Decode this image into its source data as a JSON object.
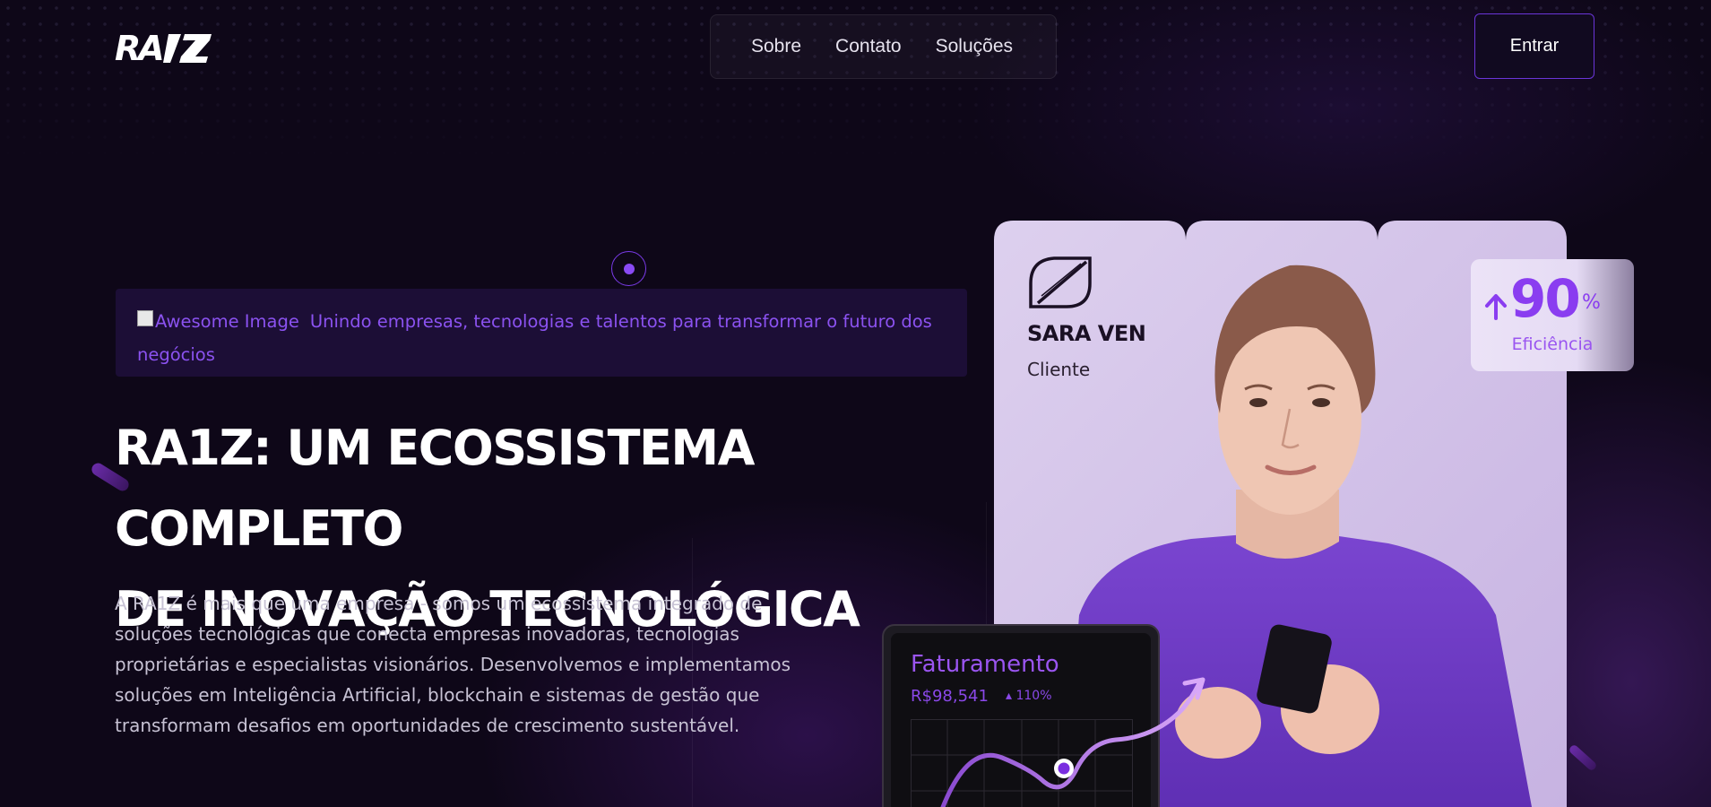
{
  "header": {
    "logo_text": "RA1Z",
    "nav": [
      {
        "label": "Sobre"
      },
      {
        "label": "Contato"
      },
      {
        "label": "Soluções"
      }
    ],
    "login_label": "Entrar"
  },
  "hero": {
    "tagline_img_alt": "Awesome Image",
    "tagline": "Unindo empresas, tecnologias e talentos para transformar o futuro dos negócios",
    "title_line1": "RA1Z: UM ECOSSISTEMA COMPLETO",
    "title_line2": "DE INOVAÇÃO TECNOLÓGICA",
    "description": "A RA1Z é mais que uma empresa - somos um ecossistema integrado de soluções tecnológicas que conecta empresas inovadoras, tecnologias proprietárias e especialistas visionários. Desenvolvemos e implementamos soluções em Inteligência Artificial, blockchain e sistemas de gestão que transformam desafios em oportunidades de crescimento sustentável."
  },
  "client": {
    "name": "SARA VEN",
    "role": "Cliente"
  },
  "efficiency": {
    "value": "90",
    "unit": "%",
    "label": "Eficiência"
  },
  "revenue": {
    "title": "Faturamento",
    "value": "R$98,541",
    "change": "110%"
  },
  "colors": {
    "background": "#0e0718",
    "accent": "#8a3df0",
    "tagline_bg": "#1c0e36",
    "photo_bg": "#d8c8ec"
  },
  "icons": {
    "up_arrow": "arrow-up-icon",
    "client_logo": "client-logo-icon",
    "marker": "marker-dot-icon"
  }
}
